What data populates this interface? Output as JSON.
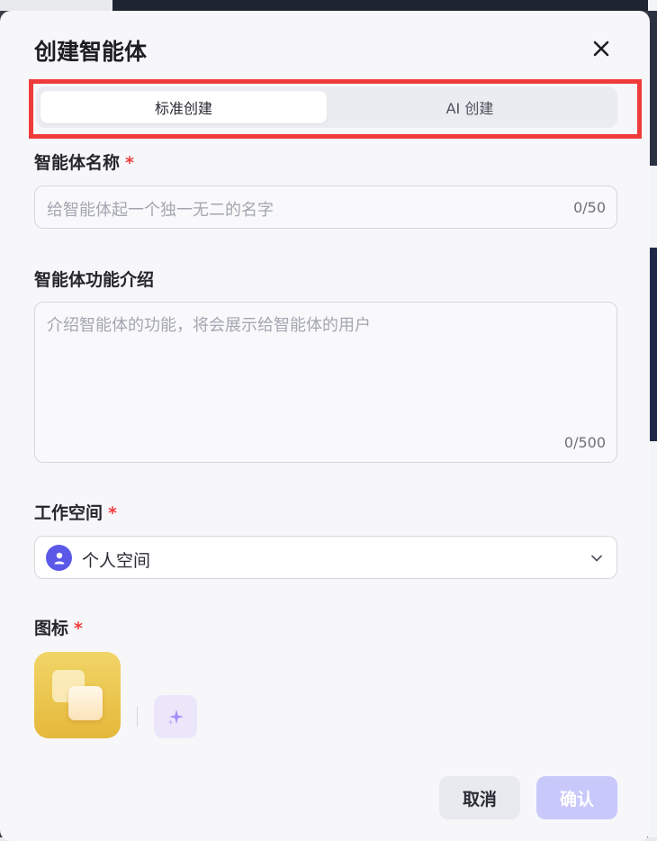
{
  "modal": {
    "title": "创建智能体",
    "tabs": [
      {
        "label": "标准创建",
        "active": true
      },
      {
        "label": "AI 创建",
        "active": false
      }
    ],
    "name_field": {
      "label": "智能体名称",
      "required_mark": "*",
      "placeholder": "给智能体起一个独一无二的名字",
      "counter": "0/50"
    },
    "description_field": {
      "label": "智能体功能介绍",
      "placeholder": "介绍智能体的功能，将会展示给智能体的用户",
      "counter": "0/500"
    },
    "workspace_field": {
      "label": "工作空间",
      "required_mark": "*",
      "value": "个人空间"
    },
    "icon_field": {
      "label": "图标",
      "required_mark": "*"
    },
    "footer": {
      "cancel_label": "取消",
      "confirm_label": "确认"
    }
  },
  "colors": {
    "accent": "#5b58e8",
    "required": "#f03d3d",
    "highlight_border": "#ef3b3b",
    "confirm_disabled": "#c8c8fb"
  },
  "icons": [
    "close-icon",
    "user-icon",
    "chevron-down-icon",
    "sparkle-icon",
    "stacked-squares-icon"
  ]
}
